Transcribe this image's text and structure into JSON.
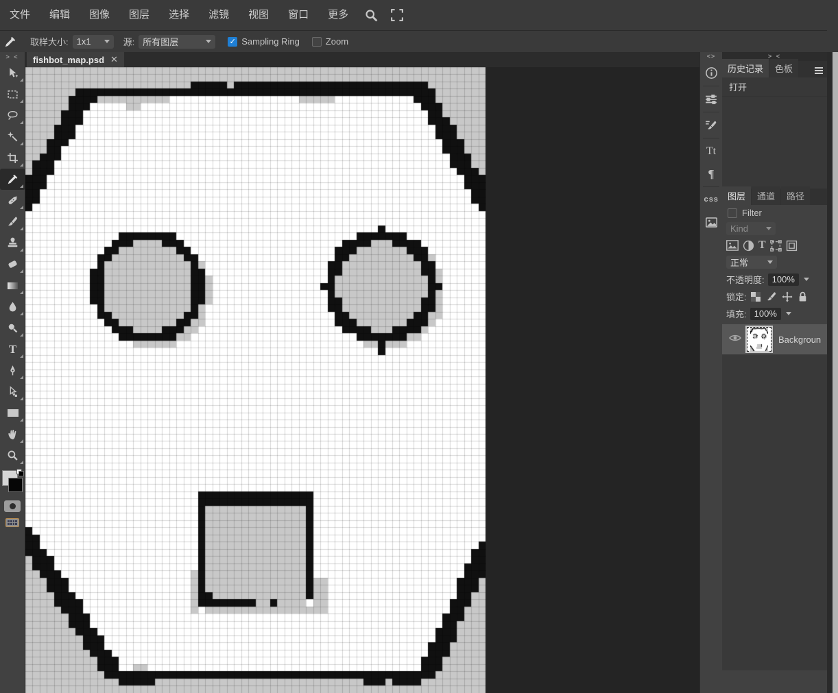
{
  "menubar": {
    "items": [
      "文件",
      "编辑",
      "图像",
      "图层",
      "选择",
      "滤镜",
      "视图",
      "窗口",
      "更多"
    ],
    "icons": [
      "search-icon",
      "fullscreen-icon"
    ]
  },
  "optionsbar": {
    "tool_icon": "eyedropper-icon",
    "sample_size_label": "取样大小:",
    "sample_size_value": "1x1",
    "source_label": "源:",
    "source_value": "所有图层",
    "sampling_ring_label": "Sampling Ring",
    "sampling_ring_checked": true,
    "zoom_label": "Zoom",
    "zoom_checked": false,
    "check_glyph": "✓"
  },
  "tabbar": {
    "tab_title": "fishbot_map.psd",
    "close_glyph": "✕"
  },
  "toolbar": {
    "collapse_glyph": "> <",
    "tools": [
      "move",
      "marquee",
      "lasso",
      "magic-wand",
      "crop",
      "eyedropper",
      "heal",
      "brush",
      "clone-stamp",
      "eraser",
      "gradient",
      "blur",
      "dodge",
      "type",
      "pen",
      "path-select",
      "rectangle",
      "hand",
      "zoom"
    ],
    "selected_tool": "eyedropper",
    "type_glyph": "T"
  },
  "right_strip": {
    "collapse_glyph": "<>",
    "icons": [
      "info-icon",
      "adjust-sliders-icon",
      "brush-settings-icon",
      "character-icon",
      "paragraph-icon",
      "css-icon",
      "image-icon"
    ],
    "character_glyph": "Tt",
    "paragraph_glyph": "¶",
    "css_glyph": "css"
  },
  "history_panel": {
    "collapse_glyph": "> <",
    "tabs": [
      "历史记录",
      "色板"
    ],
    "active_tab": "历史记录",
    "items": [
      "打开"
    ]
  },
  "layers_panel": {
    "tabs": [
      "图层",
      "通道",
      "路径"
    ],
    "active_tab": "图层",
    "filter_label": "Filter",
    "kind_value": "Kind",
    "blend_mode_value": "正常",
    "opacity_label": "不透明度:",
    "opacity_value": "100%",
    "lock_label": "锁定:",
    "fill_label": "填充:",
    "fill_value": "100%",
    "layers": [
      {
        "name": "Background",
        "visible": true,
        "selected": true
      }
    ]
  },
  "colors": {
    "accent_blue": "#1f7fd4",
    "panel_bg": "#414141",
    "workspace_bg": "#242424",
    "canvas_white": "#ffffff",
    "canvas_gray": "#c8c8c8",
    "canvas_black": "#101010"
  },
  "pixel_art": {
    "cell": 10.49,
    "cols": 64,
    "rows": 87,
    "grid_color": "rgba(0,0,0,0.16)",
    "palette": {
      "w": "#ffffff",
      "g": "#c8c8c8",
      "k": "#101010"
    },
    "thumb": {
      "w": 26,
      "h": 35,
      "scale": 0.4
    },
    "ops": [
      [
        "rect",
        0,
        0,
        63,
        2,
        "g"
      ],
      [
        "poly",
        [
          [
            0,
            2
          ],
          [
            9,
            2
          ],
          [
            0,
            20
          ]
        ],
        "g"
      ],
      [
        "poly",
        [
          [
            55.5,
            2
          ],
          [
            64.5,
            2
          ],
          [
            64.5,
            19
          ]
        ],
        "g"
      ],
      [
        "poly",
        [
          [
            -0.5,
            64.5
          ],
          [
            13,
            85.5
          ],
          [
            -0.5,
            85.5
          ]
        ],
        "g"
      ],
      [
        "poly",
        [
          [
            64.5,
            67
          ],
          [
            64.5,
            85.5
          ],
          [
            55.5,
            85.5
          ]
        ],
        "g"
      ],
      [
        "rect",
        0,
        85,
        63,
        86,
        "g"
      ],
      [
        "rect",
        9,
        4,
        19,
        4,
        "g"
      ],
      [
        "rect",
        14,
        5,
        15,
        5,
        "g"
      ],
      [
        "rect",
        38,
        4,
        42,
        4,
        "g"
      ],
      [
        "rect",
        8,
        3,
        55,
        3,
        "k"
      ],
      [
        "rect",
        29,
        2,
        55,
        2,
        "k"
      ],
      [
        "rect",
        23,
        2,
        24,
        2,
        "k"
      ],
      [
        "rect",
        25,
        2,
        27,
        2,
        "k"
      ],
      [
        "rect",
        8,
        4,
        9,
        4,
        "k"
      ],
      [
        "line",
        8,
        4,
        0,
        19,
        2,
        "k"
      ],
      [
        "line",
        55,
        3,
        64,
        19,
        2,
        "k"
      ],
      [
        "line",
        0,
        65,
        12,
        84,
        2,
        "k"
      ],
      [
        "line",
        64,
        67,
        56,
        84,
        2,
        "k"
      ],
      [
        "rect",
        12,
        84,
        56,
        84,
        "k"
      ],
      [
        "rect",
        13,
        85,
        17,
        85,
        "k"
      ],
      [
        "rect",
        47,
        85,
        49,
        85,
        "k"
      ],
      [
        "rect",
        51,
        85,
        54,
        85,
        "k"
      ],
      [
        "rect",
        15,
        83,
        16,
        83,
        "g"
      ],
      [
        "circle",
        17.9,
        31.2,
        0,
        7.9,
        "g"
      ],
      [
        "circle",
        17,
        30.5,
        6.3,
        8,
        "k"
      ],
      [
        "circle",
        17,
        30.5,
        0,
        6.3,
        "g"
      ],
      [
        "circle",
        50.4,
        31.2,
        0,
        7.9,
        "g"
      ],
      [
        "circle",
        49.5,
        30.5,
        6.3,
        8,
        "k"
      ],
      [
        "circle",
        49.5,
        30.5,
        0,
        6.3,
        "g"
      ],
      [
        "rect",
        49,
        39,
        49,
        39,
        "k"
      ],
      [
        "rect",
        23,
        70,
        23,
        75,
        "g"
      ],
      [
        "rect",
        40,
        71,
        41,
        75,
        "g"
      ],
      [
        "rect",
        25,
        75,
        41,
        75,
        "g"
      ],
      [
        "rect",
        25,
        61,
        38,
        73,
        "g"
      ],
      [
        "rect",
        24,
        59,
        39,
        60,
        "k"
      ],
      [
        "rect",
        24,
        61,
        24,
        73,
        "k"
      ],
      [
        "rect",
        39,
        61,
        39,
        73,
        "k"
      ],
      [
        "rect",
        24,
        73,
        25,
        74,
        "k"
      ],
      [
        "rect",
        26,
        74,
        31,
        74,
        "k"
      ],
      [
        "rect",
        34,
        74,
        34,
        74,
        "k"
      ],
      [
        "rect",
        32,
        74,
        33,
        74,
        "g"
      ],
      [
        "rect",
        35,
        74,
        38,
        74,
        "g"
      ]
    ]
  }
}
